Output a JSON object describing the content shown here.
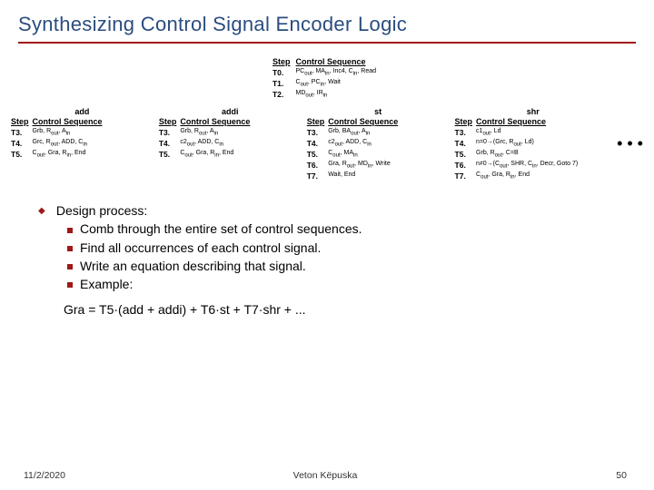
{
  "title": "Synthesizing Control Signal Encoder Logic",
  "top": {
    "h_step": "Step",
    "h_cs": "Control Sequence",
    "rows": [
      {
        "step": "T0.",
        "seq": "PC<sub>out</sub>, MA<sub>in</sub>, Inc4, C<sub>in</sub>, Read"
      },
      {
        "step": "T1.",
        "seq": "C<sub>out</sub>, PC<sub>in</sub>, Wait"
      },
      {
        "step": "T2.",
        "seq": "MD<sub>out</sub>, IR<sub>in</sub>"
      }
    ]
  },
  "ops": {
    "add": {
      "title": "add",
      "h_step": "Step",
      "h_cs": "Control Sequence",
      "rows": [
        {
          "step": "T3.",
          "seq": "Grb, R<sub>out</sub>, A<sub>in</sub>"
        },
        {
          "step": "T4.",
          "seq": "Grc, R<sub>out</sub>, ADD, C<sub>in</sub>"
        },
        {
          "step": "T5.",
          "seq": "C<sub>out</sub>, Gra, R<sub>in</sub>, End"
        }
      ]
    },
    "addi": {
      "title": "addi",
      "h_step": "Step",
      "h_cs": "Control Sequence",
      "rows": [
        {
          "step": "T3.",
          "seq": "Grb, R<sub>out</sub>, A<sub>in</sub>"
        },
        {
          "step": "T4.",
          "seq": "c2<sub>out</sub>, ADD, C<sub>in</sub>"
        },
        {
          "step": "T5.",
          "seq": "C<sub>out</sub>, Gra, R<sub>in</sub>, End"
        }
      ]
    },
    "st": {
      "title": "st",
      "h_step": "Step",
      "h_cs": "Control Sequence",
      "rows": [
        {
          "step": "T3.",
          "seq": "Grb, BA<sub>out</sub>, A<sub>in</sub>"
        },
        {
          "step": "T4.",
          "seq": "c2<sub>out</sub>, ADD, C<sub>in</sub>"
        },
        {
          "step": "T5.",
          "seq": "C<sub>out</sub>, MA<sub>in</sub>"
        },
        {
          "step": "T6.",
          "seq": "Gra, R<sub>out</sub>, MD<sub>in</sub>, Write"
        },
        {
          "step": "T7.",
          "seq": "Wait, End"
        }
      ]
    },
    "shr": {
      "title": "shr",
      "h_step": "Step",
      "h_cs": "Control Sequence",
      "rows": [
        {
          "step": "T3.",
          "seq": "c1<sub>out</sub>, Ld"
        },
        {
          "step": "T4.",
          "seq": "n=0→(Grc, R<sub>out</sub>, Ld)"
        },
        {
          "step": "T5.",
          "seq": "Grb, R<sub>out</sub>, C=B"
        },
        {
          "step": "T6.",
          "seq": "n≠0→(C<sub>out</sub>, SHR, C<sub>in</sub>, Decr, Goto 7)"
        },
        {
          "step": "T7.",
          "seq": "C<sub>out</sub>, Gra, R<sub>in</sub>, End"
        }
      ]
    }
  },
  "ellipsis": "• • •",
  "design": {
    "header": "Design process:",
    "items": [
      "Comb through the entire set of  control sequences.",
      "Find all occurrences of each control signal.",
      "Write an equation describing that signal.",
      "Example:"
    ]
  },
  "equation": "Gra = T5·(add + addi) + T6·st + T7·shr + ...",
  "footer": {
    "date": "11/2/2020",
    "author": "Veton Këpuska",
    "page": "50"
  }
}
